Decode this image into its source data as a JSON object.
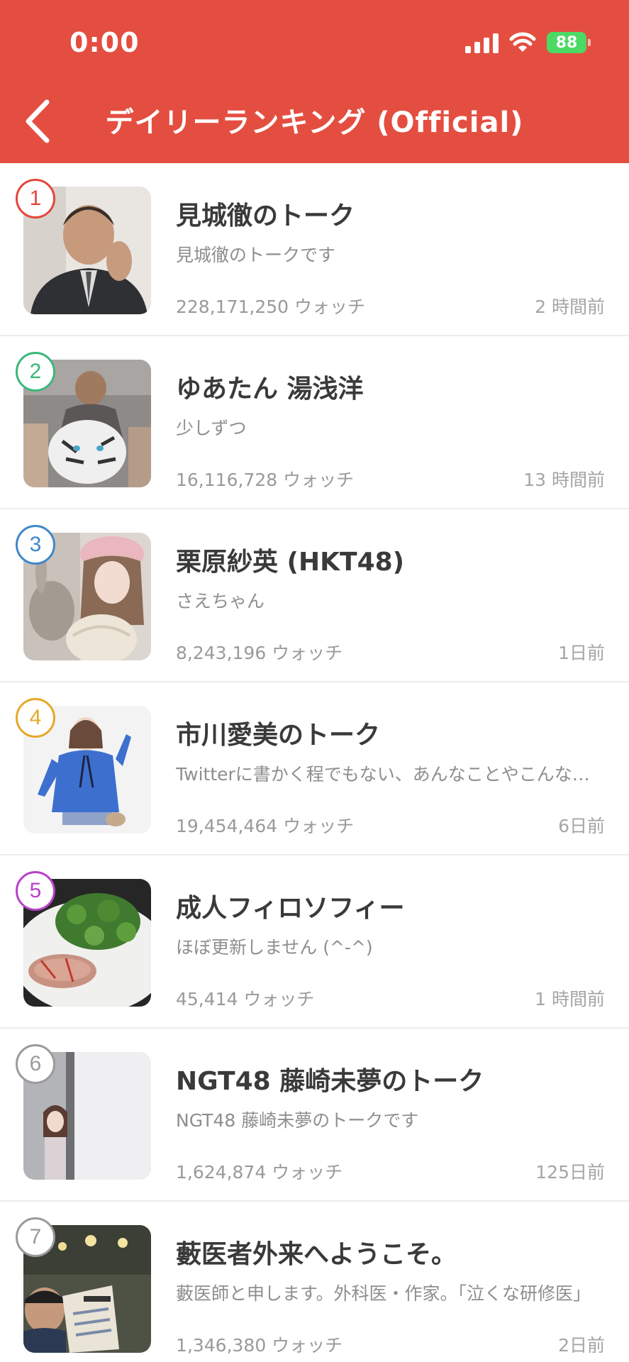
{
  "status_bar": {
    "time": "0:00",
    "battery": "88"
  },
  "header": {
    "title": "デイリーランキング (Official)"
  },
  "items": [
    {
      "rank": "1",
      "rank_color": "#e4463b",
      "name": "見城徹のトーク",
      "description": "見城徹のトークです",
      "watchers": "228,171,250 ウォッチ",
      "time": "2 時間前"
    },
    {
      "rank": "2",
      "rank_color": "#3bb77b",
      "name": "ゆあたん 湯浅洋",
      "description": "少しずつ",
      "watchers": "16,116,728 ウォッチ",
      "time": "13 時間前"
    },
    {
      "rank": "3",
      "rank_color": "#3f87c9",
      "name": "栗原紗英 (HKT48)",
      "description": "さえちゃん",
      "watchers": "8,243,196 ウォッチ",
      "time": "1日前"
    },
    {
      "rank": "4",
      "rank_color": "#e6a82a",
      "name": "市川愛美のトーク",
      "description": "Twitterに書かく程でもない、あんなことやこんなこと",
      "watchers": "19,454,464 ウォッチ",
      "time": "6日前"
    },
    {
      "rank": "5",
      "rank_color": "#b841c9",
      "name": "成人フィロソフィー",
      "description": "ほぼ更新しません (^-^)",
      "watchers": "45,414 ウォッチ",
      "time": "1 時間前"
    },
    {
      "rank": "6",
      "rank_color": "#9a9a9a",
      "name": "NGT48 藤崎未夢のトーク",
      "description": "NGT48 藤崎未夢のトークです",
      "watchers": "1,624,874 ウォッチ",
      "time": "125日前"
    },
    {
      "rank": "7",
      "rank_color": "#9a9a9a",
      "name": "藪医者外来へようこそ。",
      "description": "藪医師と申します。外科医・作家。「泣くな研修医」",
      "watchers": "1,346,380 ウォッチ",
      "time": "2日前"
    }
  ]
}
